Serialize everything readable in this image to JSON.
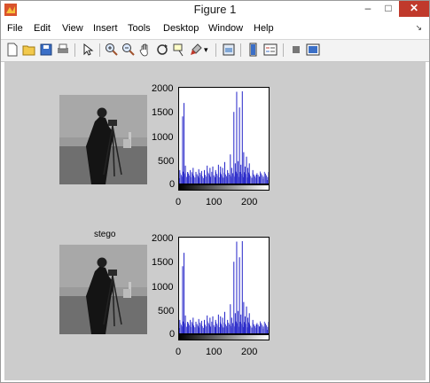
{
  "window": {
    "title": "Figure 1"
  },
  "title_controls": {
    "minimize": "–",
    "maximize": "□",
    "close": "✕"
  },
  "menu": {
    "items": [
      "File",
      "Edit",
      "View",
      "Insert",
      "Tools",
      "Desktop",
      "Window",
      "Help"
    ],
    "overflow_icon": "dock-arrow-icon"
  },
  "toolbar": {
    "icons": [
      "new-figure-icon",
      "open-file-icon",
      "save-icon",
      "print-icon",
      "select-arrow-icon",
      "zoom-in-icon",
      "zoom-out-icon",
      "pan-icon",
      "rotate-icon",
      "data-cursor-icon",
      "brush-icon",
      "dropdown-arrow-icon",
      "link-plot-icon",
      "colorbar-icon",
      "legend-icon",
      "hide-plot-tools-icon",
      "show-plot-tools-icon"
    ]
  },
  "subplots": {
    "top": {
      "image_title": "",
      "y_ticks": [
        "2000",
        "1500",
        "1000",
        "500",
        "0"
      ],
      "x_ticks": [
        "0",
        "100",
        "200"
      ]
    },
    "bottom": {
      "image_title": "stego",
      "y_ticks": [
        "2000",
        "1500",
        "1000",
        "500",
        "0"
      ],
      "x_ticks": [
        "0",
        "100",
        "200"
      ]
    }
  },
  "colors": {
    "histogram": "#2323c8",
    "canvas": "#cccccc",
    "close_button": "#c0392b"
  },
  "chart_data": [
    {
      "type": "bar",
      "title": "",
      "xlabel": "",
      "ylabel": "",
      "xlim": [
        0,
        255
      ],
      "ylim": [
        0,
        2100
      ],
      "x": [
        2,
        10,
        14,
        18,
        25,
        32,
        40,
        48,
        56,
        64,
        72,
        80,
        88,
        96,
        104,
        112,
        118,
        124,
        130,
        138,
        146,
        150,
        156,
        160,
        164,
        168,
        172,
        176,
        180,
        184,
        188,
        192,
        196,
        200,
        210,
        220,
        230,
        240,
        250
      ],
      "values": [
        300,
        1500,
        1800,
        400,
        250,
        300,
        350,
        260,
        320,
        280,
        300,
        400,
        350,
        380,
        300,
        420,
        380,
        350,
        480,
        300,
        650,
        350,
        1600,
        450,
        2050,
        500,
        1700,
        420,
        2060,
        700,
        380,
        600,
        350,
        450,
        300,
        200,
        150,
        100,
        80
      ]
    },
    {
      "type": "bar",
      "title": "",
      "xlabel": "",
      "ylabel": "",
      "xlim": [
        0,
        255
      ],
      "ylim": [
        0,
        2100
      ],
      "x": [
        2,
        10,
        14,
        18,
        25,
        32,
        40,
        48,
        56,
        64,
        72,
        80,
        88,
        96,
        104,
        112,
        118,
        124,
        130,
        138,
        146,
        150,
        156,
        160,
        164,
        168,
        172,
        176,
        180,
        184,
        188,
        192,
        196,
        200,
        210,
        220,
        230,
        240,
        250
      ],
      "values": [
        300,
        1500,
        1800,
        400,
        250,
        300,
        350,
        260,
        320,
        280,
        300,
        400,
        350,
        380,
        300,
        420,
        380,
        350,
        480,
        300,
        650,
        350,
        1600,
        450,
        2050,
        500,
        1700,
        420,
        2060,
        700,
        380,
        600,
        350,
        450,
        300,
        200,
        150,
        100,
        80
      ]
    }
  ]
}
